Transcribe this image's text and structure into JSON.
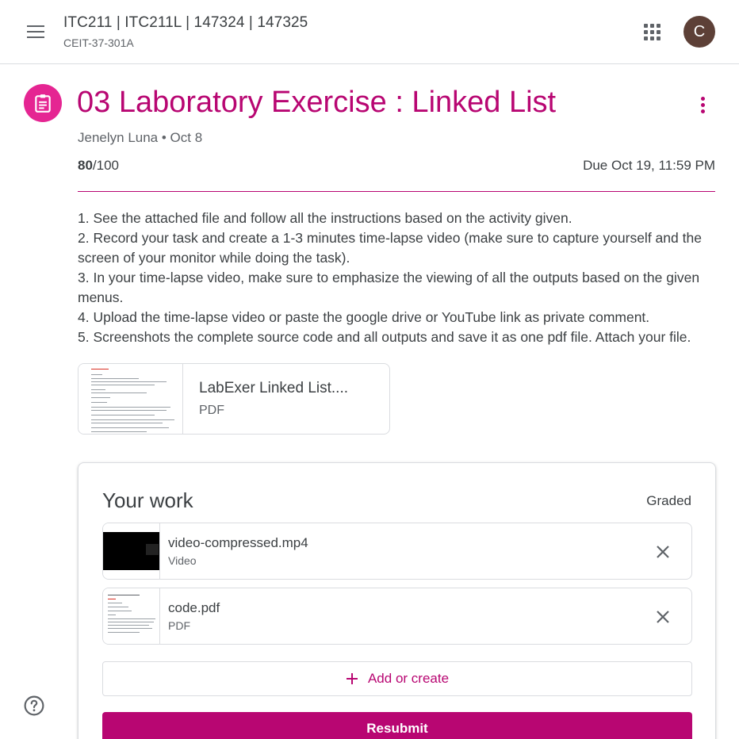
{
  "header": {
    "class_title": "ITC211 | ITC211L | 147324 | 147325",
    "class_section": "CEIT-37-301A",
    "avatar_letter": "C"
  },
  "assignment": {
    "title": "03 Laboratory Exercise : Linked List",
    "meta": "Jenelyn Luna • Oct 8",
    "points_earned": "80",
    "points_total": "/100",
    "due": "Due Oct 19, 11:59 PM",
    "instructions": [
      "1. See the attached file and follow all the instructions based on the activity given.",
      "2. Record your task and create a 1-3 minutes time-lapse video (make sure to capture yourself and the screen of your monitor while doing the task).",
      "3. In your time-lapse video, make sure to emphasize the viewing of all the outputs based on the given menus.",
      "4. Upload the time-lapse video or paste the google drive or YouTube link as private comment.",
      "5. Screenshots the complete source code and all outputs and save it as one pdf file. Attach your file."
    ],
    "attachment": {
      "name": "LabExer Linked List....",
      "type": "PDF"
    }
  },
  "work": {
    "title": "Your work",
    "status": "Graded",
    "files": [
      {
        "name": "video-compressed.mp4",
        "type": "Video"
      },
      {
        "name": "code.pdf",
        "type": "PDF"
      }
    ],
    "add_label": "Add or create",
    "resubmit_label": "Resubmit"
  },
  "colors": {
    "accent": "#b80672",
    "icon_bg": "#e52592",
    "avatar_bg": "#5d4037"
  },
  "icons": {
    "menu": "menu-icon",
    "apps": "apps-grid-icon",
    "assignment": "assignment-icon",
    "more": "more-vert-icon",
    "remove": "close-icon",
    "add": "plus-icon",
    "help": "help-icon"
  }
}
